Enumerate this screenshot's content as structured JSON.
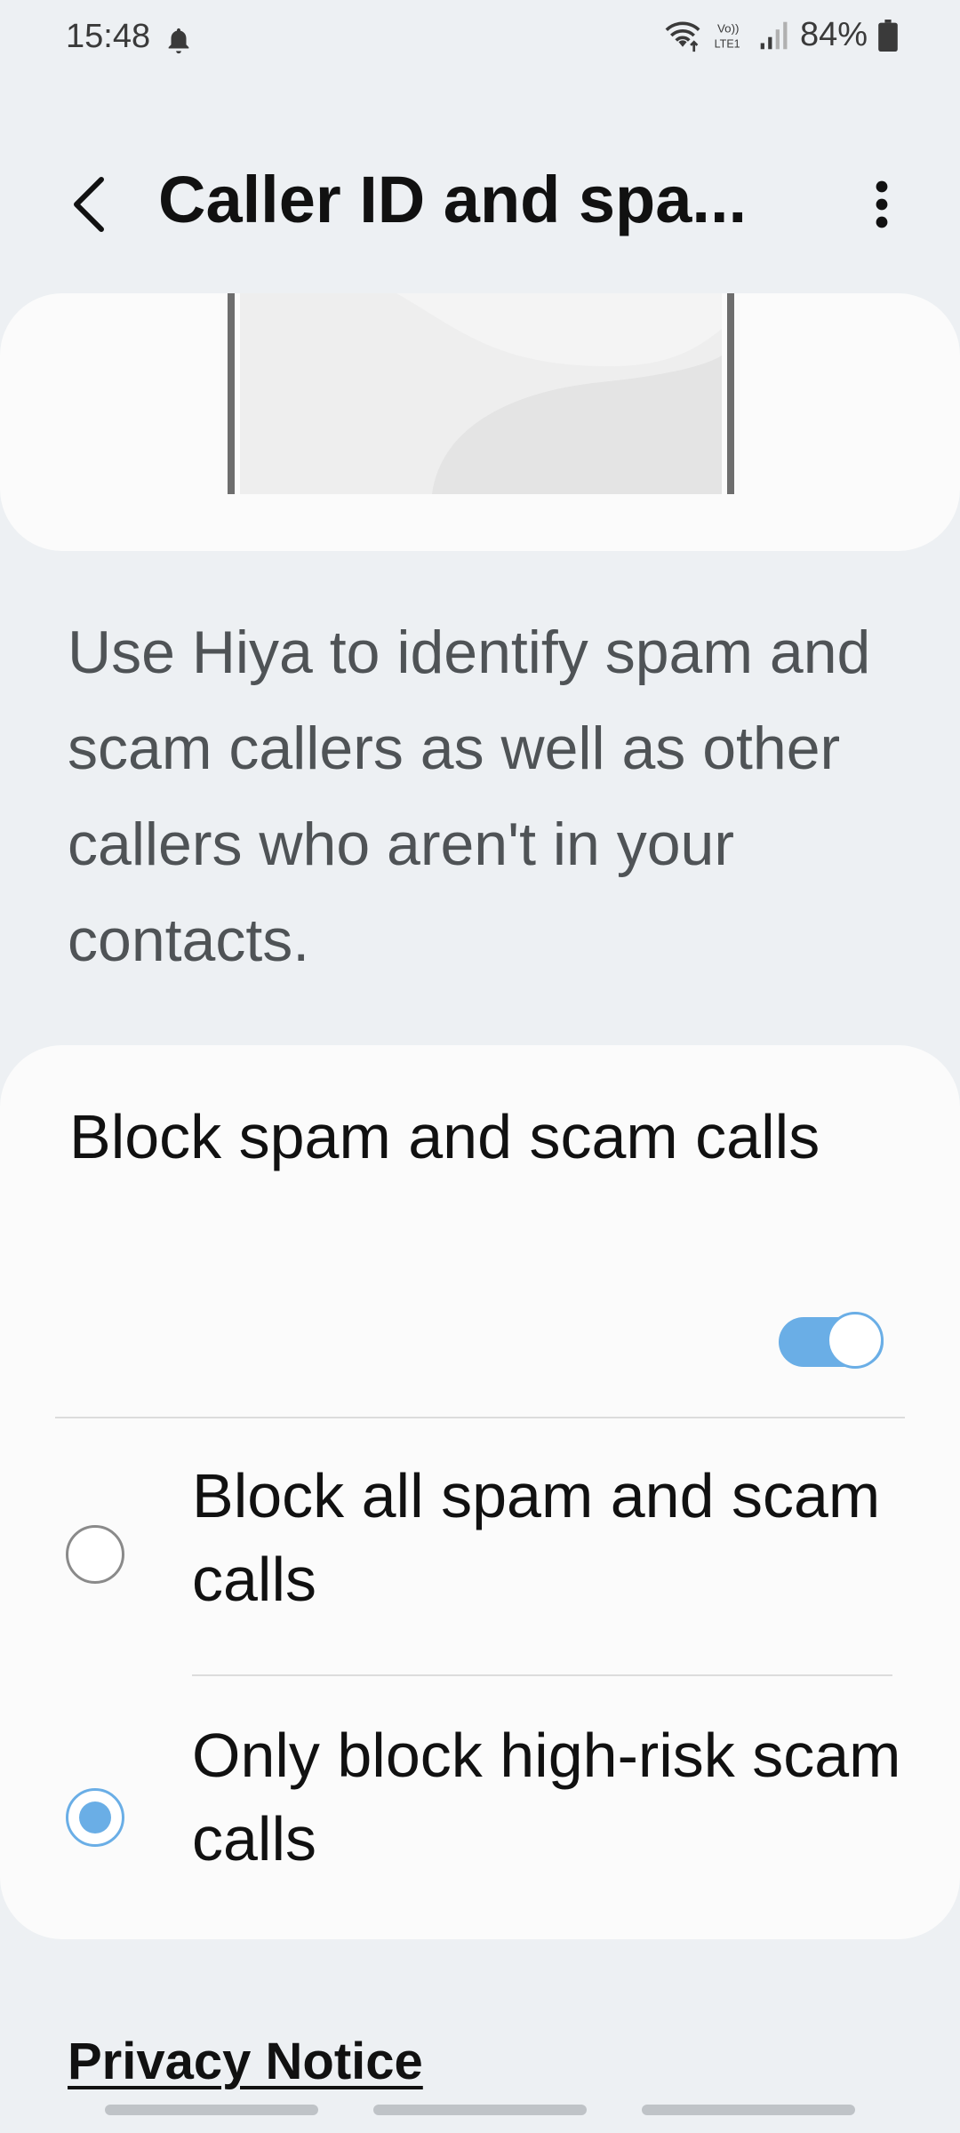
{
  "status_bar": {
    "time": "15:48",
    "battery": "84%",
    "icons": [
      "bell-icon",
      "wifi-icon",
      "volte-icon",
      "signal-icon",
      "battery-icon"
    ]
  },
  "app_bar": {
    "title": "Caller ID and spa...",
    "back_icon": "chevron-left-icon",
    "more_icon": "more-vert-icon"
  },
  "description": "Use Hiya to identify spam and scam callers as well as other callers who aren't in your contacts.",
  "block_setting": {
    "title": "Block spam and scam calls",
    "enabled": true
  },
  "options": [
    {
      "label": "Block all spam and scam calls",
      "selected": false
    },
    {
      "label": "Only block high-risk scam calls",
      "selected": true
    }
  ],
  "privacy_notice": "Privacy Notice",
  "colors": {
    "accent": "#6aaee6",
    "background": "#edf0f3",
    "card": "#fbfbfb"
  }
}
